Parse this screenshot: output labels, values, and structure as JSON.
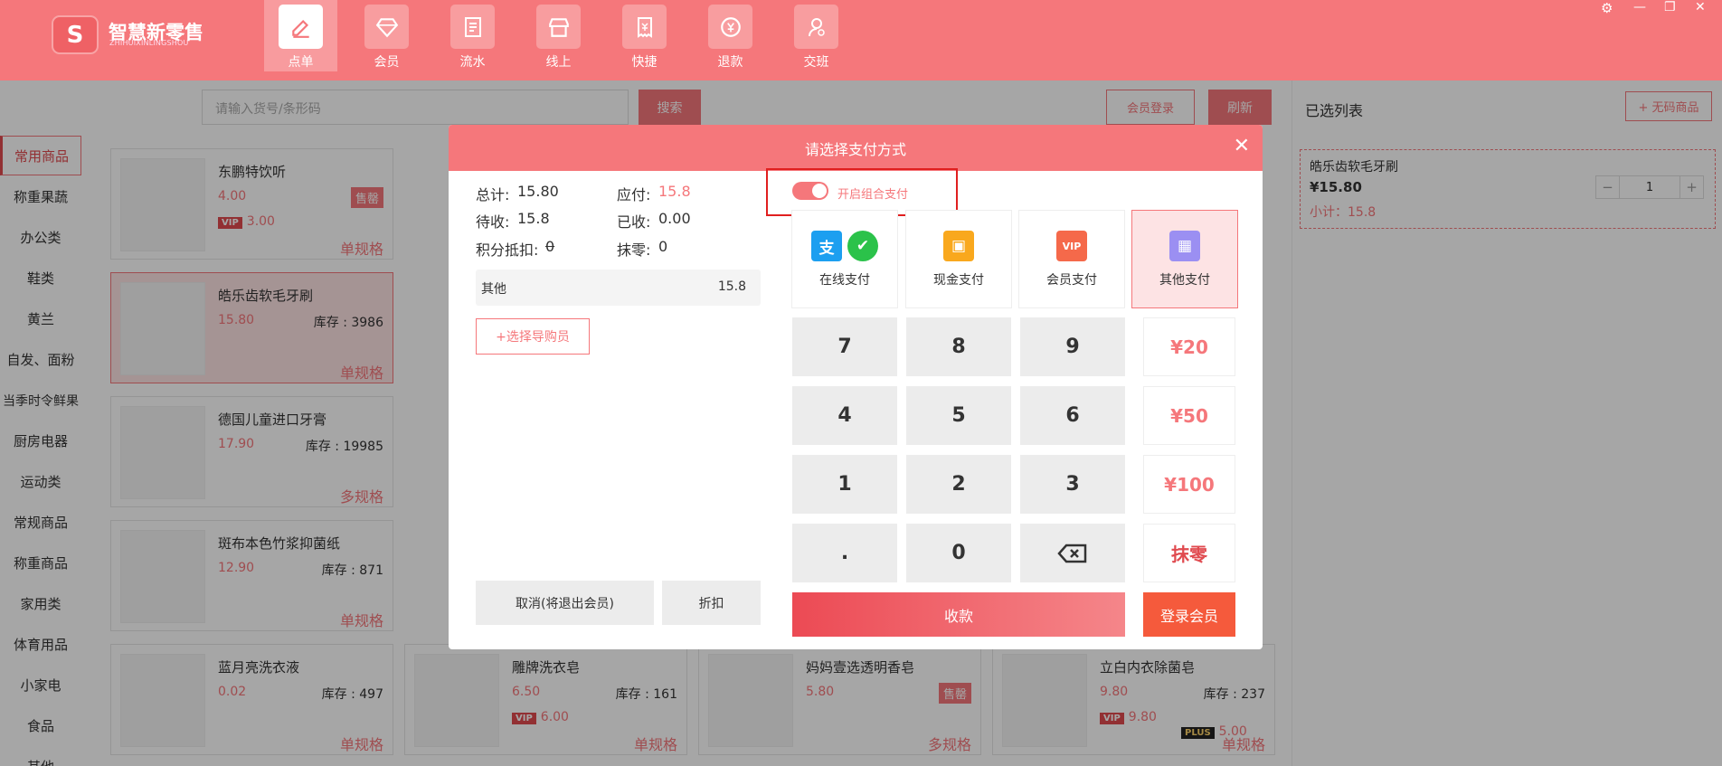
{
  "app": {
    "logo_char": "S",
    "name": "智慧新零售",
    "sub": "ZHIHUIXINLINGSHOU"
  },
  "nav": [
    {
      "label": "点单",
      "icon": "edit-icon"
    },
    {
      "label": "会员",
      "icon": "diamond-icon"
    },
    {
      "label": "流水",
      "icon": "document-icon"
    },
    {
      "label": "线上",
      "icon": "store-icon"
    },
    {
      "label": "快捷",
      "icon": "receipt-icon"
    },
    {
      "label": "退款",
      "icon": "refund-icon"
    },
    {
      "label": "交班",
      "icon": "user-icon"
    }
  ],
  "window": {
    "settings": "⚙",
    "minimize": "—",
    "restore": "❐",
    "close": "✕"
  },
  "search": {
    "placeholder": "请输入货号/条形码",
    "button": "搜索"
  },
  "header_buttons": {
    "member_login": "会员登录",
    "refresh": "刷新"
  },
  "categories": [
    "常用商品",
    "称重果蔬",
    "办公类",
    "鞋类",
    "黄兰",
    "自发、面粉",
    "当季时令鲜果",
    "厨房电器",
    "运动类",
    "常规商品",
    "称重商品",
    "家用类",
    "体育用品",
    "小家电",
    "食品",
    "其他"
  ],
  "products": [
    {
      "name": "东鹏特饮听",
      "price": "4.00",
      "stock": "",
      "vip": "3.00",
      "tag": "售罄",
      "spec": "单规格"
    },
    {
      "name": "皓乐齿软毛牙刷",
      "price": "15.80",
      "stock": "库存 : 3986",
      "vip": "",
      "tag": "",
      "spec": "单规格"
    },
    {
      "name": "德国儿童进口牙膏",
      "price": "17.90",
      "stock": "库存 : 19985",
      "vip": "",
      "tag": "",
      "spec": "多规格"
    },
    {
      "name": "斑布本色竹浆抑菌纸",
      "price": "12.90",
      "stock": "库存 : 871",
      "vip": "",
      "tag": "",
      "spec": "单规格"
    },
    {
      "name": "蓝月亮洗衣液",
      "price": "0.02",
      "stock": "库存 : 497",
      "vip": "",
      "tag": "",
      "spec": "单规格"
    },
    {
      "name": "雕牌洗衣皂",
      "price": "6.50",
      "stock": "库存 : 161",
      "vip": "6.00",
      "tag": "",
      "spec": "单规格"
    },
    {
      "name": "妈妈壹选透明香皂",
      "price": "5.80",
      "stock": "",
      "vip": "",
      "tag": "售罄",
      "spec": "多规格"
    },
    {
      "name": "立白内衣除菌皂",
      "price": "9.80",
      "stock": "库存 : 237",
      "vip": "9.80",
      "plus": "5.00",
      "tag": "",
      "spec": "单规格"
    }
  ],
  "right_panel": {
    "title": "已选列表",
    "no_code_btn": "+ 无码商品",
    "item": {
      "name": "皓乐齿软毛牙刷",
      "price": "¥15.80",
      "qty": "1",
      "minus": "−",
      "plus": "+",
      "subtotal": "小计：15.8"
    }
  },
  "modal": {
    "title": "请选择支付方式",
    "close": "✕",
    "summary": {
      "total_label": "总计:",
      "total": "15.80",
      "due_label": "应付:",
      "due": "15.8",
      "pending_label": "待收:",
      "pending": "15.8",
      "received_label": "已收:",
      "received": "0.00",
      "points_label": "积分抵扣:",
      "points": "0",
      "rounding_label": "抹零:",
      "rounding": "0"
    },
    "other_row": {
      "label": "其他",
      "value": "15.8"
    },
    "guide_btn": "+选择导购员",
    "combo_label": "开启组合支付",
    "pay_methods": [
      {
        "label": "在线支付"
      },
      {
        "label": "现金支付"
      },
      {
        "label": "会员支付"
      },
      {
        "label": "其他支付"
      }
    ],
    "keys": [
      "7",
      "8",
      "9",
      "4",
      "5",
      "6",
      "1",
      "2",
      "3",
      ".",
      "0"
    ],
    "quick": [
      "¥20",
      "¥50",
      "¥100",
      "抹零"
    ],
    "cancel": "取消(将退出会员)",
    "discount": "折扣",
    "collect": "收款",
    "login_member": "登录会员"
  },
  "colors": {
    "brand": "#f5777b",
    "accent": "#e04a4f"
  }
}
